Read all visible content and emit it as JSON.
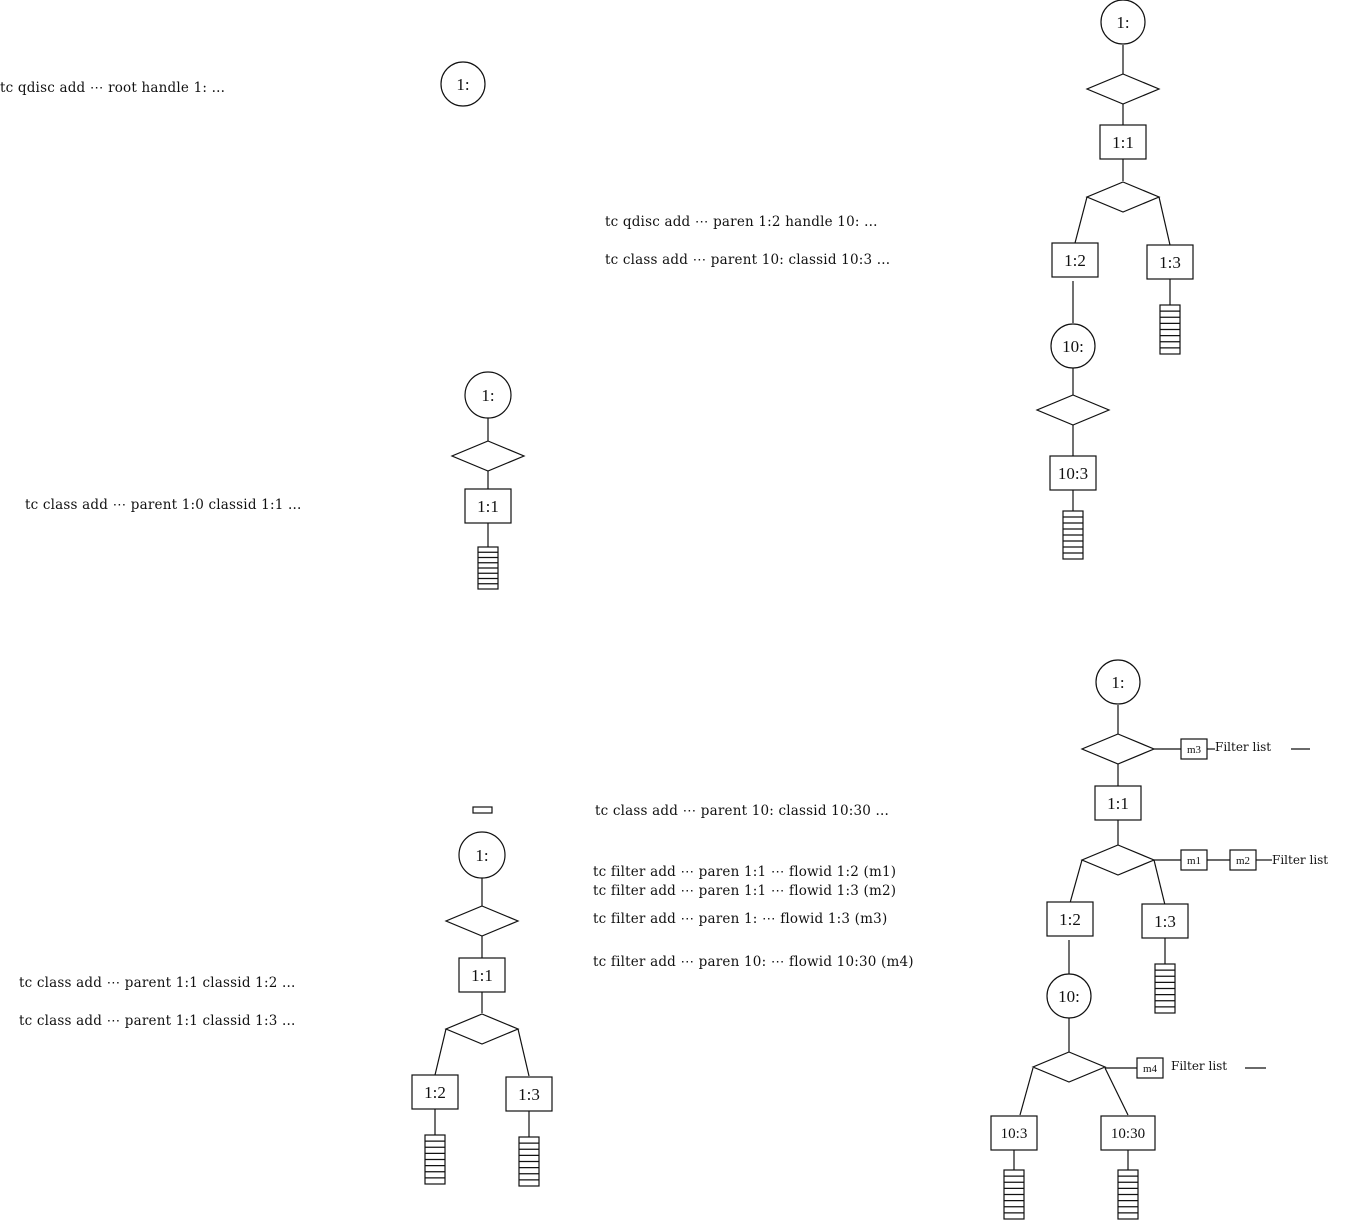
{
  "commands": {
    "step1": [
      "tc qdisc add ⋯ root handle 1: ..."
    ],
    "step2": [
      "tc class add ⋯ parent 1:0 classid 1:1 ..."
    ],
    "step3": [
      "tc class add ⋯ parent 1:1 classid 1:2 ...",
      "tc class add ⋯ parent 1:1 classid 1:3 ..."
    ],
    "step4": [
      "tc qdisc add ⋯ paren 1:2 handle 10: ...",
      "tc class add ⋯ parent 10: classid 10:3 ..."
    ],
    "step5": [
      "tc class add ⋯ parent 10: classid 10:30 ...",
      "tc filter add ⋯ paren 1:1 ⋯ flowid 1:2 (m1)",
      "tc filter add ⋯ paren 1:1 ⋯ flowid 1:3 (m2)",
      "tc filter add ⋯ paren 1: ⋯ flowid 1:3 (m3)",
      "tc filter add ⋯ paren 10: ⋯ flowid 10:30 (m4)"
    ]
  },
  "diagrams": {
    "d1": {
      "qdiscs": [
        "1:"
      ]
    },
    "d2": {
      "qdiscs": [
        "1:"
      ],
      "classes": [
        "1:1"
      ]
    },
    "d3": {
      "qdiscs": [
        "1:"
      ],
      "classes": [
        "1:1",
        "1:2",
        "1:3"
      ]
    },
    "d4": {
      "qdiscs": [
        "1:",
        "10:"
      ],
      "classes": [
        "1:1",
        "1:2",
        "1:3",
        "10:3"
      ]
    },
    "d5": {
      "qdiscs": [
        "1:",
        "10:"
      ],
      "classes": [
        "1:1",
        "1:2",
        "1:3",
        "10:3",
        "10:30"
      ],
      "filters": [
        "m1",
        "m2",
        "m3",
        "m4"
      ],
      "filter_list_label": "Filter list"
    }
  },
  "legend_colors": {
    "stroke": "#111111",
    "background": "#ffffff"
  }
}
